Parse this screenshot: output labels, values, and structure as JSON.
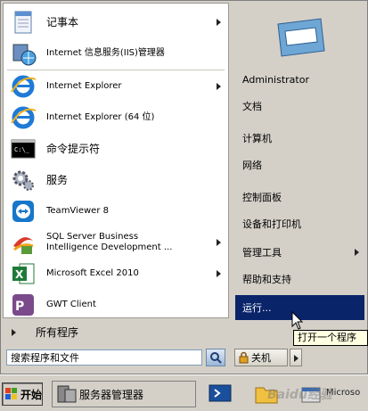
{
  "left_items": [
    {
      "label": "记事本",
      "icon": "notepad-icon",
      "has_arrow": true
    },
    {
      "label": "Internet 信息服务(IIS)管理器",
      "icon": "iis-manager-icon",
      "has_arrow": false
    },
    {
      "label": "Internet Explorer",
      "icon": "internet-explorer-icon",
      "has_arrow": true
    },
    {
      "label": "Internet Explorer (64 位)",
      "icon": "internet-explorer-64-icon",
      "has_arrow": false
    },
    {
      "label": "命令提示符",
      "icon": "command-prompt-icon",
      "has_arrow": false
    },
    {
      "label": "服务",
      "icon": "services-icon",
      "has_arrow": false
    },
    {
      "label": "TeamViewer 8",
      "icon": "teamviewer-icon",
      "has_arrow": false
    },
    {
      "label_line1": "SQL Server Business",
      "label_line2": "Intelligence Development ...",
      "icon": "sql-server-icon",
      "has_arrow": true
    },
    {
      "label": "Microsoft Excel 2010",
      "icon": "excel-icon",
      "has_arrow": true
    },
    {
      "label": "GWT Client",
      "icon": "gwt-client-icon",
      "has_arrow": false
    }
  ],
  "all_programs": "所有程序",
  "search": {
    "value": "搜索程序和文件"
  },
  "shutdown": {
    "label": "关机"
  },
  "right_items": [
    {
      "label": "Administrator",
      "has_arrow": false
    },
    {
      "label": "文档",
      "has_arrow": false
    },
    {
      "label": "计算机",
      "has_arrow": false
    },
    {
      "label": "网络",
      "has_arrow": false
    },
    {
      "label": "控制面板",
      "has_arrow": false
    },
    {
      "label": "设备和打印机",
      "has_arrow": false
    },
    {
      "label": "管理工具",
      "has_arrow": true
    },
    {
      "label": "帮助和支持",
      "has_arrow": false
    },
    {
      "label": "运行...",
      "has_arrow": false,
      "highlighted": true
    }
  ],
  "tooltip": "打开一个程序",
  "taskbar": {
    "start_label": "开始",
    "server_manager_label": "服务器管理器",
    "ms_text": "Microso"
  },
  "watermark": "Baidu经验",
  "colors": {
    "highlight": "#0a246a",
    "menu_bg": "#d4d0c8",
    "tooltip_bg": "#ffffe1"
  }
}
